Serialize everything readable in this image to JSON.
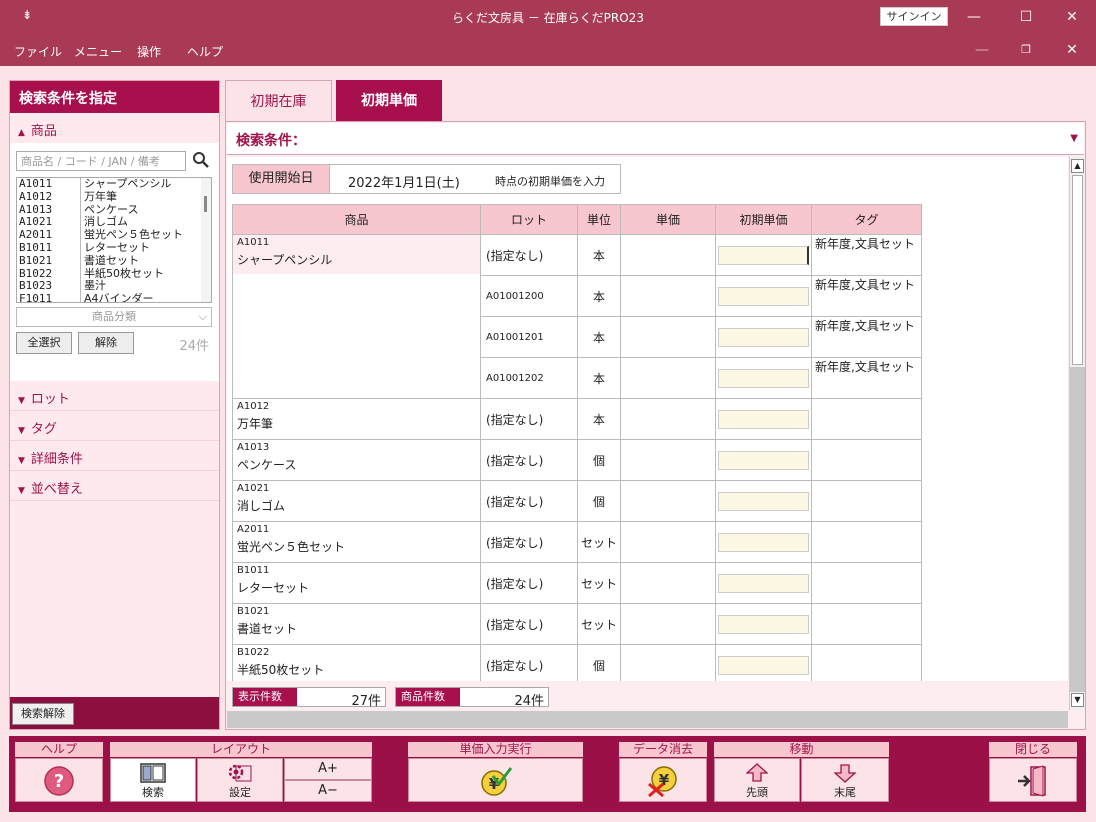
{
  "window": {
    "title": "らくだ文房具 － 在庫らくだPRO23",
    "signin_label": "サインイン",
    "menu": [
      "ファイル",
      "メニュー",
      "操作",
      "ヘルプ"
    ]
  },
  "left_panel": {
    "header": "検索条件を指定",
    "product_section": "商品",
    "search_placeholder": "商品名 / コード / JAN / 備考",
    "products": [
      {
        "code": "A1011",
        "name": "シャープペンシル"
      },
      {
        "code": "A1012",
        "name": "万年筆"
      },
      {
        "code": "A1013",
        "name": "ペンケース"
      },
      {
        "code": "A1021",
        "name": "消しゴム"
      },
      {
        "code": "A2011",
        "name": "蛍光ペン５色セット"
      },
      {
        "code": "B1011",
        "name": "レターセット"
      },
      {
        "code": "B1021",
        "name": "書道セット"
      },
      {
        "code": "B1022",
        "name": "半紙50枚セット"
      },
      {
        "code": "B1023",
        "name": "墨汁"
      },
      {
        "code": "F1011",
        "name": "A4バインダー"
      }
    ],
    "category_placeholder": "商品分類",
    "select_all_label": "全選択",
    "clear_label": "解除",
    "product_count": "24件",
    "sections": [
      "ロット",
      "タグ",
      "詳細条件",
      "並べ替え"
    ],
    "clear_search_label": "検索解除"
  },
  "tabs": [
    {
      "label": "初期在庫",
      "active": false
    },
    {
      "label": "初期単価",
      "active": true
    }
  ],
  "main": {
    "search_condition_label": "検索条件：",
    "start_date_label": "使用開始日",
    "start_date_value": "2022年1月1日(土)",
    "start_date_note": "時点の初期単価を入力",
    "columns": [
      "商品",
      "ロット",
      "単位",
      "単価",
      "初期単価",
      "タグ"
    ],
    "rows": [
      {
        "code": "A1011",
        "name": "シャープペンシル",
        "lot": "(指定なし)",
        "unit": "本",
        "tag": "新年度,文具セット",
        "group_start": true,
        "highlight": true
      },
      {
        "code": "",
        "name": "",
        "lot": "A01001200",
        "unit": "本",
        "tag": "新年度,文具セット",
        "group_start": false
      },
      {
        "code": "",
        "name": "",
        "lot": "A01001201",
        "unit": "本",
        "tag": "新年度,文具セット",
        "group_start": false
      },
      {
        "code": "",
        "name": "",
        "lot": "A01001202",
        "unit": "本",
        "tag": "新年度,文具セット",
        "group_start": false
      },
      {
        "code": "A1012",
        "name": "万年筆",
        "lot": "(指定なし)",
        "unit": "本",
        "tag": "",
        "group_start": true
      },
      {
        "code": "A1013",
        "name": "ペンケース",
        "lot": "(指定なし)",
        "unit": "個",
        "tag": "",
        "group_start": true
      },
      {
        "code": "A1021",
        "name": "消しゴム",
        "lot": "(指定なし)",
        "unit": "個",
        "tag": "",
        "group_start": true
      },
      {
        "code": "A2011",
        "name": "蛍光ペン５色セット",
        "lot": "(指定なし)",
        "unit": "セット",
        "tag": "",
        "group_start": true
      },
      {
        "code": "B1011",
        "name": "レターセット",
        "lot": "(指定なし)",
        "unit": "セット",
        "tag": "",
        "group_start": true
      },
      {
        "code": "B1021",
        "name": "書道セット",
        "lot": "(指定なし)",
        "unit": "セット",
        "tag": "",
        "group_start": true
      },
      {
        "code": "B1022",
        "name": "半紙50枚セット",
        "lot": "(指定なし)",
        "unit": "個",
        "tag": "",
        "group_start": true
      }
    ],
    "display_count_label": "表示件数",
    "display_count_value": "27件",
    "product_count_label": "商品件数",
    "product_count_value": "24件"
  },
  "toolbar": {
    "help_group": "ヘルプ",
    "layout_group": "レイアウト",
    "search_label": "検索",
    "settings_label": "設定",
    "font_up": "A+",
    "font_down": "A−",
    "execute_group": "単価入力実行",
    "delete_group": "データ消去",
    "move_group": "移動",
    "first_label": "先頭",
    "last_label": "末尾",
    "close_group": "閉じる"
  },
  "colors": {
    "accent": "#a70f4d",
    "titlebar": "#a83a54",
    "header_pink": "#f8c6cf",
    "input_cream": "#fdf8e4"
  }
}
